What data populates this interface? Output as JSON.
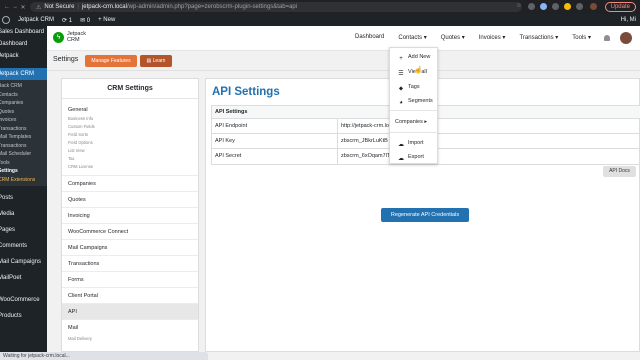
{
  "browser": {
    "not_secure": "Not Secure",
    "url_host": "jetpack-crm.local",
    "url_path": "/wp-admin/admin.php?page=zerobscrm-plugin-settings&tab=api",
    "update_label": "Update"
  },
  "adminbar": {
    "site_name": "Jetpack CRM",
    "updates": "1",
    "comments": "0",
    "new_label": "+ New",
    "greeting": "Hi, Mi"
  },
  "sidebar": {
    "items": [
      "Sales Dashboard",
      "Dashboard",
      "Jetpack",
      "Jetpack CRM"
    ],
    "sub": [
      "Back CRM",
      "Contacts",
      "Companies",
      "Quotes",
      "Invoices",
      "Transactions",
      "Mail Templates",
      "Transactions",
      "Mail Scheduler",
      "Tools",
      "Settings",
      "CRM Extensions"
    ],
    "bottom": [
      "Posts",
      "Media",
      "Pages",
      "Comments",
      "Mail Campaigns",
      "MailPoet",
      "WooCommerce",
      "Products"
    ]
  },
  "crm_header": {
    "logo_line1": "Jetpack",
    "logo_line2": "CRM",
    "menu": [
      "Dashboard",
      "Contacts ▾",
      "Quotes ▾",
      "Invoices ▾",
      "Transactions ▾",
      "Tools ▾"
    ]
  },
  "settings_bar": {
    "title": "Settings",
    "manage_features": "Manage Features",
    "learn": "Learn"
  },
  "settings_panel": {
    "title": "CRM Settings",
    "general": "General",
    "general_sub": [
      "Business Info",
      "Custom Fields",
      "Field Sorts",
      "Field Options",
      "List View",
      "Tax",
      "CRM License"
    ],
    "rows": [
      "Companies",
      "Quotes",
      "Invoicing",
      "WooCommerce Connect",
      "Mail Campaigns",
      "Transactions",
      "Forms",
      "Client Portal",
      "API",
      "Mail"
    ],
    "mail_sub": "Mail Delivery"
  },
  "api": {
    "title": "API Settings",
    "table_header": "API Settings",
    "rows": [
      {
        "key": "API Endpoint",
        "value": "http://jetpack-crm.lo"
      },
      {
        "key": "API Key",
        "value": "zbscrm_JBkrLuKtB"
      },
      {
        "key": "API Secret",
        "value": "zbscrm_6xOqam7lT"
      }
    ],
    "docs_button": "API Docs",
    "regenerate_button": "Regenerate API Credentials"
  },
  "contacts_dropdown": {
    "items": [
      {
        "icon": "+",
        "label": "Add New"
      },
      {
        "icon": "☰",
        "label": "View all"
      },
      {
        "icon": "⬥",
        "label": "Tags"
      },
      {
        "icon": "◕",
        "label": "Segments"
      },
      {
        "icon": "",
        "label": "Companies ▸"
      },
      {
        "icon": "☁",
        "label": "Import"
      },
      {
        "icon": "☁",
        "label": "Export"
      }
    ]
  },
  "status_bar": "Waiting for jetpack-crm.local...",
  "colors": {
    "accent": "#2271b1",
    "orange_button": "#e4733a",
    "learn_button": "#b4542b",
    "admin_bg": "#1d2327"
  }
}
